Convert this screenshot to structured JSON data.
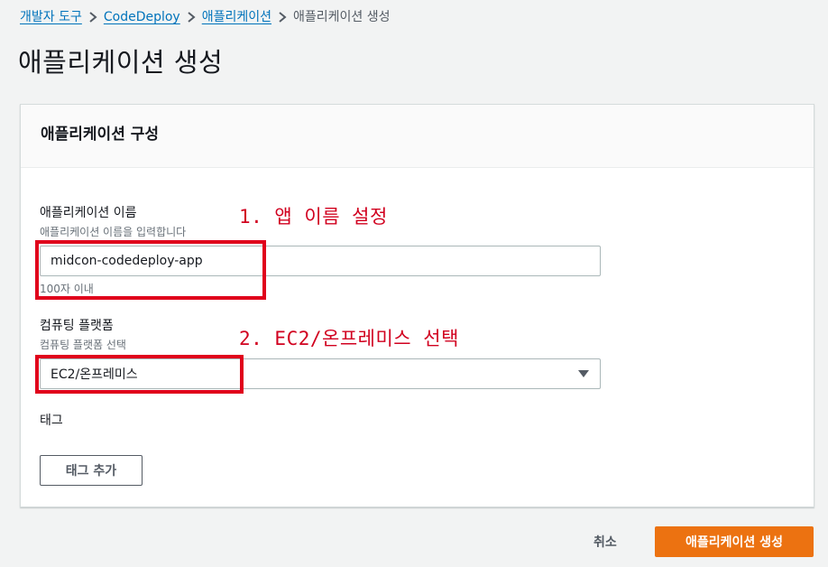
{
  "breadcrumb": {
    "items": [
      {
        "label": "개발자 도구",
        "link": true
      },
      {
        "label": "CodeDeploy",
        "link": true
      },
      {
        "label": "애플리케이션",
        "link": true
      },
      {
        "label": "애플리케이션 생성",
        "link": false
      }
    ]
  },
  "page": {
    "title": "애플리케이션 생성"
  },
  "panel": {
    "title": "애플리케이션 구성",
    "app_name": {
      "label": "애플리케이션 이름",
      "description": "애플리케이션 이름을 입력합니다",
      "value": "midcon-codedeploy-app",
      "constraint": "100자 이내"
    },
    "platform": {
      "label": "컴퓨팅 플랫폼",
      "description": "컴퓨팅 플랫폼 선택",
      "selected": "EC2/온프레미스"
    },
    "tags": {
      "label": "태그",
      "add_button": "태그 추가"
    }
  },
  "annotations": {
    "step1": "1. 앱 이름 설정",
    "step2": "2. EC2/온프레미스 선택"
  },
  "footer": {
    "cancel": "취소",
    "create": "애플리케이션 생성"
  },
  "colors": {
    "link": "#0073bb",
    "primary": "#ec7211",
    "annotation": "#e0001b"
  }
}
